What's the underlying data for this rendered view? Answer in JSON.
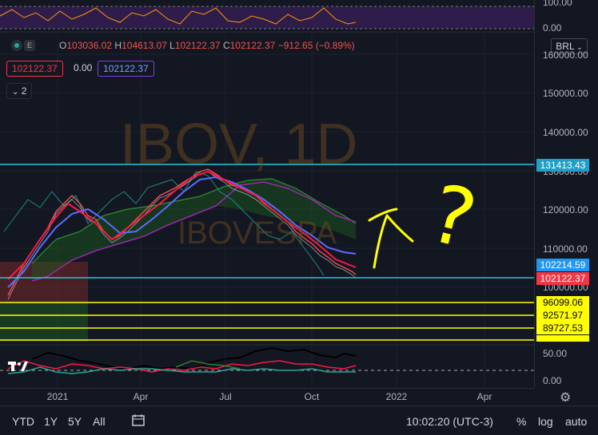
{
  "ohlc": {
    "o_label": "O",
    "o": "103036.02",
    "h_label": "H",
    "h": "104613.07",
    "l_label": "L",
    "l": "102122.37",
    "c_label": "C",
    "c": "102122.37",
    "change": "−912.65 (−0.89%)"
  },
  "inputs": {
    "left_value": "102122.37",
    "mid_value": "0.00",
    "right_value": "102122.37"
  },
  "collapse_count": "2",
  "watermark": {
    "symbol": "IBOV, 1D",
    "name": "IBOVESPA"
  },
  "currency_button": "BRL",
  "price_axis": {
    "ticks": [
      "160000.00",
      "150000.00",
      "140000.00",
      "130000.00",
      "120000.00",
      "110000.00",
      "100000.00"
    ],
    "top_indicator_tick": "100.00",
    "top_indicator_zero": "0.00",
    "bottom_indicator_ticks": [
      "50.00",
      "0.00"
    ],
    "tags": [
      {
        "label": "131413.43",
        "bg": "#1ea0c8",
        "fg": "#ffffff"
      },
      {
        "label": "102214.59",
        "bg": "#2196f3",
        "fg": "#ffffff"
      },
      {
        "label": "102122.37",
        "bg": "#f23645",
        "fg": "#ffffff"
      },
      {
        "label": "96099.06",
        "bg": "#ffff00",
        "fg": "#000000"
      },
      {
        "label": "92571.97",
        "bg": "#ffff00",
        "fg": "#000000"
      },
      {
        "label": "89727.53",
        "bg": "#ffff00",
        "fg": "#000000"
      }
    ]
  },
  "time_axis": [
    "2021",
    "Apr",
    "Jul",
    "Oct",
    "2022",
    "Apr"
  ],
  "toolbar": {
    "ranges": [
      "YTD",
      "1Y",
      "5Y",
      "All"
    ],
    "time": "10:02:20 (UTC-3)",
    "percent": "%",
    "log": "log",
    "auto": "auto"
  },
  "annotation_text": "?",
  "colors": {
    "bg": "#131722",
    "ichimoku_cloud": "#1b5e20",
    "hline_cyan": "#26c6da",
    "hline_yellow": "#ffff00",
    "candle_up": "#26a69a",
    "candle_down": "#ef5350",
    "ema_red": "#ff1744",
    "ema_blue": "#5b6cff",
    "purple": "#9c27b0"
  }
}
